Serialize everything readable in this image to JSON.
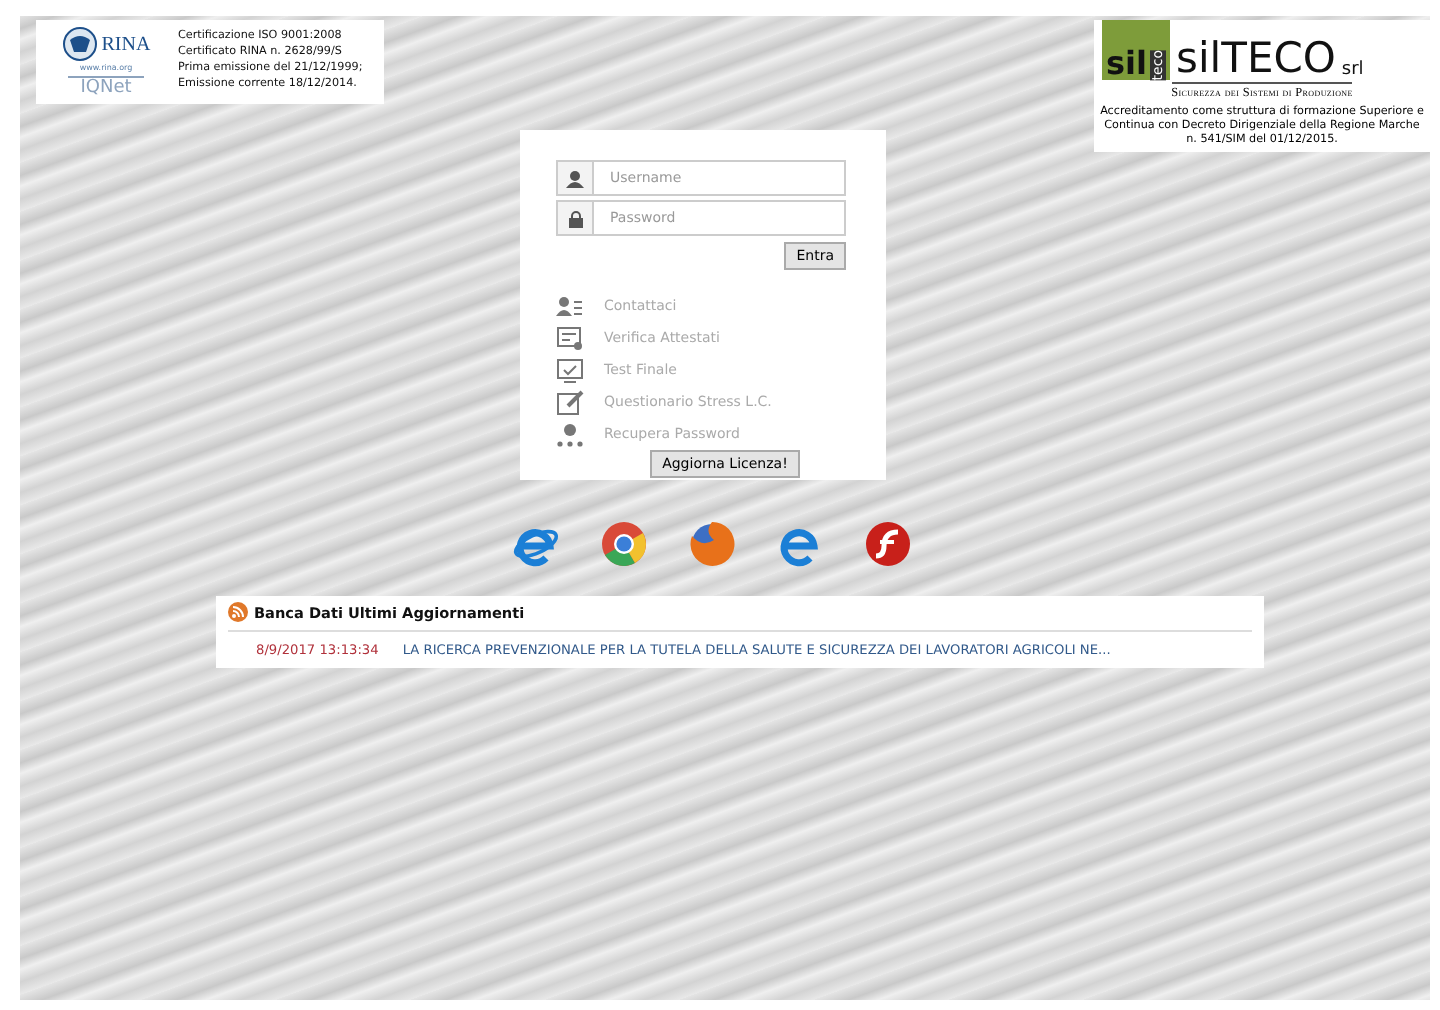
{
  "certification": {
    "logo_text": "RINA",
    "logo_url": "www.rina.org",
    "logo_subtext": "IQNet",
    "lines": [
      "Certificazione ISO 9001:2008",
      "Certificato RINA n. 2628/99/S",
      "Prima emissione del 21/12/1999;",
      "Emissione corrente 18/12/2014."
    ]
  },
  "brand": {
    "logo_mark": "sil",
    "logo_vertical": "teco",
    "logo_name": "silTECO",
    "logo_suffix": "srl",
    "tagline": "Sicurezza dei Sistemi di Produzione",
    "accreditation": "Accreditamento come struttura di formazione Superiore e Continua con Decreto Dirigenziale della Regione Marche n. 541/SIM del 01/12/2015."
  },
  "login": {
    "username": {
      "placeholder": "Username"
    },
    "password": {
      "placeholder": "Password"
    },
    "submit": "Entra",
    "links": [
      {
        "label": "Contattaci",
        "kind": "contact"
      },
      {
        "label": "Verifica Attestati",
        "kind": "certificate"
      },
      {
        "label": "Test Finale",
        "kind": "test"
      },
      {
        "label": "Questionario Stress L.C.",
        "kind": "survey"
      },
      {
        "label": "Recupera Password",
        "kind": "recover"
      }
    ],
    "license_button": "Aggiorna Licenza!"
  },
  "browsers": [
    {
      "kind": "ie"
    },
    {
      "kind": "chrome"
    },
    {
      "kind": "firefox"
    },
    {
      "kind": "edge"
    },
    {
      "kind": "flash"
    }
  ],
  "news": {
    "title": "Banca Dati Ultimi Aggiornamenti",
    "items": [
      {
        "date": "8/9/2017 13:13:34",
        "text": "LA RICERCA PREVENZIONALE PER LA TUTELA DELLA SALUTE E SICUREZZA DEI LAVORATORI AGRICOLI NE..."
      }
    ]
  }
}
